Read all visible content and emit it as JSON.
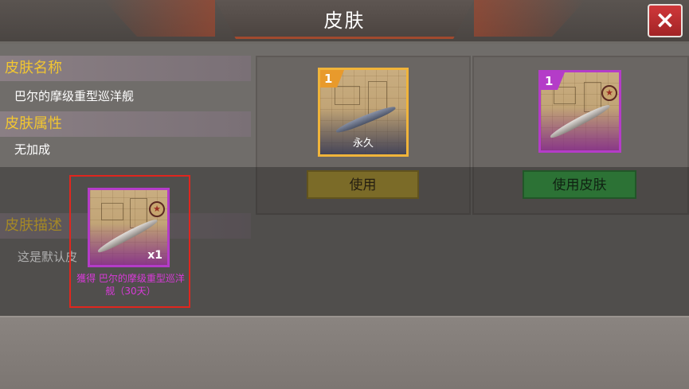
{
  "header": {
    "title": "皮肤",
    "close_icon": "×"
  },
  "info": {
    "skin_name_heading": "皮肤名称",
    "skin_name_value": "巴尔的摩级重型巡洋舰",
    "skin_attr_heading": "皮肤属性",
    "skin_attr_value": "无加成",
    "skin_desc_heading": "皮肤描述",
    "skin_desc_value": "这是默认皮"
  },
  "skins": [
    {
      "badge": "1",
      "label": "永久",
      "button": "使用",
      "frame_color": "#f0b43a",
      "button_color": "#c4a640"
    },
    {
      "badge": "1",
      "label": "",
      "button": "使用皮肤",
      "frame_color": "#b43cc8",
      "button_color": "#3aa548"
    }
  ],
  "highlight_item": {
    "count": "x1",
    "description": "獲得 巴尔的摩级重型巡洋舰（30天）",
    "frame_color": "#b43cc8"
  }
}
